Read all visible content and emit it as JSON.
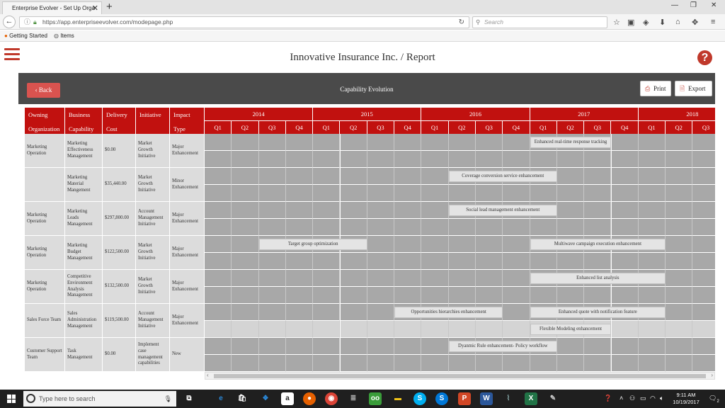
{
  "browser": {
    "tab_title": "Enterprise Evolver - Set Up Orga",
    "url": "https://app.enterpriseevolver.com/modepage.php",
    "search_placeholder": "Search",
    "bookmarks": [
      "Getting Started",
      "Items"
    ]
  },
  "app": {
    "title": "Innovative Insurance Inc. / Report",
    "help": "?"
  },
  "panel": {
    "back_label": "Back",
    "title": "Capability Evolution",
    "print_label": "Print",
    "export_label": "Export"
  },
  "table": {
    "headers": [
      {
        "line1": "Owning",
        "line2": "Organization"
      },
      {
        "line1": "Business",
        "line2": "Capability"
      },
      {
        "line1": "Delivery",
        "line2": "Cost"
      },
      {
        "line1": "Initiative",
        "line2": ""
      },
      {
        "line1": "Impact",
        "line2": "Type"
      }
    ],
    "years": [
      "2014",
      "2015",
      "2016",
      "2017",
      "2018"
    ],
    "quarters": [
      "Q1",
      "Q2",
      "Q3",
      "Q4"
    ],
    "rows": [
      {
        "org": "Marketing Operation",
        "capability": "Marketing Effectiveness Management",
        "cost": "$0.00",
        "initiative": "Market Growth Initiative",
        "impact": "Major Enhancement"
      },
      {
        "org": "",
        "capability": "Marketing Material Mangement",
        "cost": "$35,440.00",
        "initiative": "Market Growth Initiative",
        "impact": "Minor Enhancement"
      },
      {
        "org": "Marketing Operation",
        "capability": "Marketing Leads Management",
        "cost": "$297,800.00",
        "initiative": "Account Management Initiative",
        "impact": "Major Enhancement"
      },
      {
        "org": "Marketing Operation",
        "capability": "Marketing Budget Management",
        "cost": "$122,500.00",
        "initiative": "Market Growth Initiative",
        "impact": "Major Enhancement"
      },
      {
        "org": "Marketing Operation",
        "capability": "Competitive Environment Analysis Management",
        "cost": "$132,500.00",
        "initiative": "Market Growth Initiative",
        "impact": "Major Enhancement"
      },
      {
        "org": "Sales Force Team",
        "capability": "Sales Administration Management",
        "cost": "$119,500.00",
        "initiative": "Account Management Initiative",
        "impact": "Major Enhancement"
      },
      {
        "org": "Customer Support Team",
        "capability": "Task Management",
        "cost": "$0.00",
        "initiative": "Implement case management capabilities",
        "impact": "New"
      }
    ],
    "bars": [
      {
        "label": "Enhanced real-time response tracking"
      },
      {
        "label": "Coverage conversion service enhancement"
      },
      {
        "label": "Social lead management enhancement"
      },
      {
        "label": "Target group optimization"
      },
      {
        "label": "Multiwave campaign execution enhancement"
      },
      {
        "label": "Enhanced list analysis"
      },
      {
        "label": "Opportunities hierarchies enhancement"
      },
      {
        "label": "Enhanced quote with notification feature"
      },
      {
        "label": "Flexible Modeling enhancement"
      },
      {
        "label": "Dyanmic Rule enhancement- Policy workflow"
      }
    ]
  },
  "taskbar": {
    "search_placeholder": "Type here to search",
    "time": "9:11 AM",
    "date": "10/19/2017",
    "notifications": "2"
  },
  "colors": {
    "accent": "#c1110f",
    "panel": "#4a4a4a",
    "grid": "#a8a8a8"
  }
}
